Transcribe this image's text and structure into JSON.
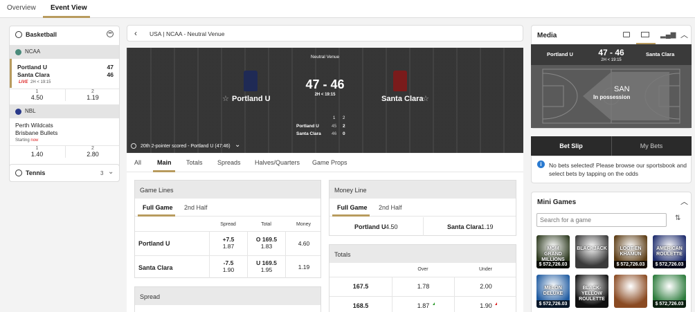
{
  "topnav": {
    "tabs": [
      "Overview",
      "Event View"
    ]
  },
  "sidebar": {
    "sport_title": "Basketball",
    "leagues": [
      {
        "name": "NCAA",
        "team1": "Portland U",
        "score1": "47",
        "team2": "Santa Clara",
        "score2": "46",
        "live": "LIVE",
        "clock": "2H < 19:15",
        "odds": [
          {
            "label": "1",
            "value": "4.50"
          },
          {
            "label": "2",
            "value": "1.19"
          }
        ]
      },
      {
        "name": "NBL",
        "team1": "Perth Wildcats",
        "team2": "Brisbane Bullets",
        "starting_prefix": "Starting",
        "starting_word": "now",
        "odds": [
          {
            "label": "1",
            "value": "1.40"
          },
          {
            "label": "2",
            "value": "2.80"
          }
        ]
      }
    ],
    "tennis": {
      "title": "Tennis",
      "count": "3"
    }
  },
  "breadcrumb": "USA | NCAA - Neutral Venue",
  "hero": {
    "venue": "Neutral Venue",
    "home": "Portland U",
    "away": "Santa Clara",
    "score": "47 - 46",
    "clock": "2H < 19:15",
    "half_headers": [
      "1",
      "2"
    ],
    "home_row": [
      "Portland U",
      "45",
      "2"
    ],
    "away_row": [
      "Santa Clara",
      "46",
      "0"
    ],
    "last_event": "20th 2-pointer scored - Portland U (47:46)",
    "colors": {
      "home_jersey": "#1f2a55",
      "away_jersey": "#7a1b1b"
    }
  },
  "market_tabs": [
    "All",
    "Main",
    "Totals",
    "Spreads",
    "Halves/Quarters",
    "Game Props"
  ],
  "game_lines": {
    "title": "Game Lines",
    "tabs": [
      "Full Game",
      "2nd Half"
    ],
    "headers": [
      "Spread",
      "Total",
      "Money"
    ],
    "rows": [
      {
        "team": "Portland U",
        "spread_line": "+7.5",
        "spread_odds": "1.87",
        "total_line": "O 169.5",
        "total_odds": "1.83",
        "money": "4.60"
      },
      {
        "team": "Santa Clara",
        "spread_line": "-7.5",
        "spread_odds": "1.90",
        "total_line": "U 169.5",
        "total_odds": "1.95",
        "money": "1.19"
      }
    ]
  },
  "spread_panel": {
    "title": "Spread"
  },
  "money_line": {
    "title": "Money Line",
    "tabs": [
      "Full Game",
      "2nd Half"
    ],
    "home": "Portland U",
    "home_odds": "4.50",
    "away": "Santa Clara",
    "away_odds": "1.19"
  },
  "totals": {
    "title": "Totals",
    "headers": [
      "Over",
      "Under"
    ],
    "rows": [
      {
        "line": "167.5",
        "over": "1.78",
        "under": "2.00"
      },
      {
        "line": "168.5",
        "over": "1.87",
        "under": "1.90"
      }
    ]
  },
  "media": {
    "title": "Media",
    "home": "Portland U",
    "away": "Santa Clara",
    "score": "47 - 46",
    "clock": "2H < 19:15",
    "possession_team": "SAN",
    "possession_text": "In possession"
  },
  "betslip": {
    "tabs": [
      "Bet Slip",
      "My Bets"
    ],
    "message": "No bets selected! Please browse our sportsbook and select bets by tapping on the odds"
  },
  "mini_games": {
    "title": "Mini Games",
    "search_placeholder": "Search for a game",
    "games": [
      {
        "name": "MGM GRAND MILLIONS",
        "price": "$ 572,726.03",
        "color": "#2d3a1f"
      },
      {
        "name": "BLACKJACK",
        "price": "",
        "color": "#3a3a3a"
      },
      {
        "name": "LOOT-EN KHAMUN",
        "price": "$ 572,726.03",
        "color": "#5a3a12"
      },
      {
        "name": "AMERICAN ROULETTE",
        "price": "$ 572,726.03",
        "color": "#1c2a6b"
      },
      {
        "name": "MELON DELUXE",
        "price": "$ 572,726.03",
        "color": "#1e5aa0"
      },
      {
        "name": "BLACK-YELLOW ROULETTE",
        "price": "",
        "color": "#111111"
      },
      {
        "name": "",
        "price": "",
        "color": "#8a4a22"
      },
      {
        "name": "",
        "price": "$ 572,726.03",
        "color": "#2a7a3a"
      }
    ]
  }
}
